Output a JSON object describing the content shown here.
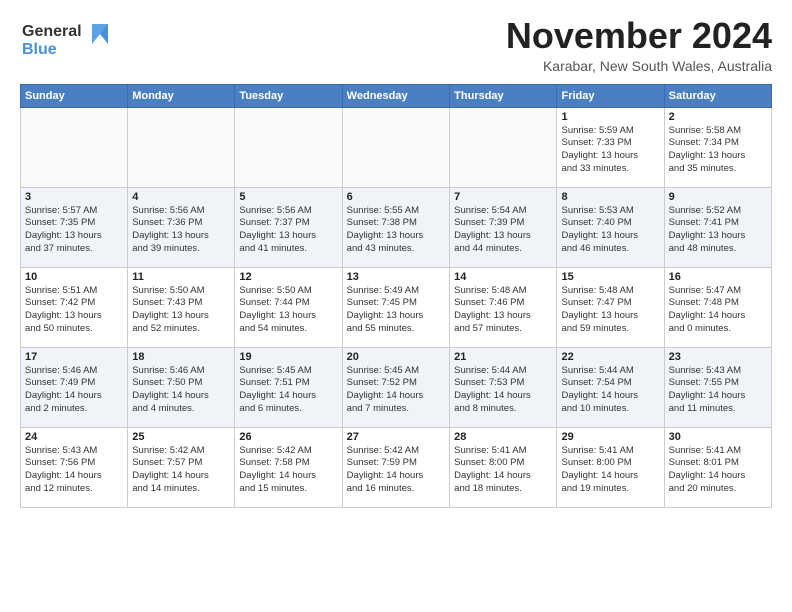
{
  "header": {
    "logo_line1": "General",
    "logo_line2": "Blue",
    "month_title": "November 2024",
    "subtitle": "Karabar, New South Wales, Australia"
  },
  "weekdays": [
    "Sunday",
    "Monday",
    "Tuesday",
    "Wednesday",
    "Thursday",
    "Friday",
    "Saturday"
  ],
  "weeks": [
    [
      {
        "day": "",
        "info": ""
      },
      {
        "day": "",
        "info": ""
      },
      {
        "day": "",
        "info": ""
      },
      {
        "day": "",
        "info": ""
      },
      {
        "day": "",
        "info": ""
      },
      {
        "day": "1",
        "info": "Sunrise: 5:59 AM\nSunset: 7:33 PM\nDaylight: 13 hours\nand 33 minutes."
      },
      {
        "day": "2",
        "info": "Sunrise: 5:58 AM\nSunset: 7:34 PM\nDaylight: 13 hours\nand 35 minutes."
      }
    ],
    [
      {
        "day": "3",
        "info": "Sunrise: 5:57 AM\nSunset: 7:35 PM\nDaylight: 13 hours\nand 37 minutes."
      },
      {
        "day": "4",
        "info": "Sunrise: 5:56 AM\nSunset: 7:36 PM\nDaylight: 13 hours\nand 39 minutes."
      },
      {
        "day": "5",
        "info": "Sunrise: 5:56 AM\nSunset: 7:37 PM\nDaylight: 13 hours\nand 41 minutes."
      },
      {
        "day": "6",
        "info": "Sunrise: 5:55 AM\nSunset: 7:38 PM\nDaylight: 13 hours\nand 43 minutes."
      },
      {
        "day": "7",
        "info": "Sunrise: 5:54 AM\nSunset: 7:39 PM\nDaylight: 13 hours\nand 44 minutes."
      },
      {
        "day": "8",
        "info": "Sunrise: 5:53 AM\nSunset: 7:40 PM\nDaylight: 13 hours\nand 46 minutes."
      },
      {
        "day": "9",
        "info": "Sunrise: 5:52 AM\nSunset: 7:41 PM\nDaylight: 13 hours\nand 48 minutes."
      }
    ],
    [
      {
        "day": "10",
        "info": "Sunrise: 5:51 AM\nSunset: 7:42 PM\nDaylight: 13 hours\nand 50 minutes."
      },
      {
        "day": "11",
        "info": "Sunrise: 5:50 AM\nSunset: 7:43 PM\nDaylight: 13 hours\nand 52 minutes."
      },
      {
        "day": "12",
        "info": "Sunrise: 5:50 AM\nSunset: 7:44 PM\nDaylight: 13 hours\nand 54 minutes."
      },
      {
        "day": "13",
        "info": "Sunrise: 5:49 AM\nSunset: 7:45 PM\nDaylight: 13 hours\nand 55 minutes."
      },
      {
        "day": "14",
        "info": "Sunrise: 5:48 AM\nSunset: 7:46 PM\nDaylight: 13 hours\nand 57 minutes."
      },
      {
        "day": "15",
        "info": "Sunrise: 5:48 AM\nSunset: 7:47 PM\nDaylight: 13 hours\nand 59 minutes."
      },
      {
        "day": "16",
        "info": "Sunrise: 5:47 AM\nSunset: 7:48 PM\nDaylight: 14 hours\nand 0 minutes."
      }
    ],
    [
      {
        "day": "17",
        "info": "Sunrise: 5:46 AM\nSunset: 7:49 PM\nDaylight: 14 hours\nand 2 minutes."
      },
      {
        "day": "18",
        "info": "Sunrise: 5:46 AM\nSunset: 7:50 PM\nDaylight: 14 hours\nand 4 minutes."
      },
      {
        "day": "19",
        "info": "Sunrise: 5:45 AM\nSunset: 7:51 PM\nDaylight: 14 hours\nand 6 minutes."
      },
      {
        "day": "20",
        "info": "Sunrise: 5:45 AM\nSunset: 7:52 PM\nDaylight: 14 hours\nand 7 minutes."
      },
      {
        "day": "21",
        "info": "Sunrise: 5:44 AM\nSunset: 7:53 PM\nDaylight: 14 hours\nand 8 minutes."
      },
      {
        "day": "22",
        "info": "Sunrise: 5:44 AM\nSunset: 7:54 PM\nDaylight: 14 hours\nand 10 minutes."
      },
      {
        "day": "23",
        "info": "Sunrise: 5:43 AM\nSunset: 7:55 PM\nDaylight: 14 hours\nand 11 minutes."
      }
    ],
    [
      {
        "day": "24",
        "info": "Sunrise: 5:43 AM\nSunset: 7:56 PM\nDaylight: 14 hours\nand 12 minutes."
      },
      {
        "day": "25",
        "info": "Sunrise: 5:42 AM\nSunset: 7:57 PM\nDaylight: 14 hours\nand 14 minutes."
      },
      {
        "day": "26",
        "info": "Sunrise: 5:42 AM\nSunset: 7:58 PM\nDaylight: 14 hours\nand 15 minutes."
      },
      {
        "day": "27",
        "info": "Sunrise: 5:42 AM\nSunset: 7:59 PM\nDaylight: 14 hours\nand 16 minutes."
      },
      {
        "day": "28",
        "info": "Sunrise: 5:41 AM\nSunset: 8:00 PM\nDaylight: 14 hours\nand 18 minutes."
      },
      {
        "day": "29",
        "info": "Sunrise: 5:41 AM\nSunset: 8:00 PM\nDaylight: 14 hours\nand 19 minutes."
      },
      {
        "day": "30",
        "info": "Sunrise: 5:41 AM\nSunset: 8:01 PM\nDaylight: 14 hours\nand 20 minutes."
      }
    ]
  ]
}
